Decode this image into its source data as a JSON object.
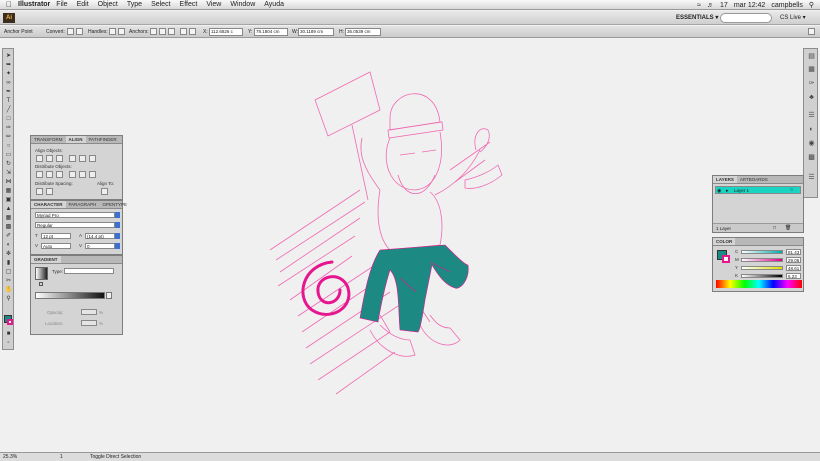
{
  "menubar": {
    "apple": "",
    "app_name": "Illustrator",
    "items": [
      "File",
      "Edit",
      "Object",
      "Type",
      "Select",
      "Effect",
      "View",
      "Window",
      "Ayuda"
    ],
    "status": {
      "battery": "17",
      "clock": "mar 12:42",
      "user": "campbells"
    }
  },
  "appbar": {
    "logo": "Ai",
    "workspace": "ESSENTIALS ▾",
    "cslive": "CS Live ▾"
  },
  "control": {
    "mode": "Anchor Point",
    "convert_label": "Convert:",
    "handles_label": "Handles:",
    "anchors_label": "Anchors:",
    "x_label": "X:",
    "x_value": "112.6826 c",
    "y_label": "Y:",
    "y_value": "78.1804 cm",
    "w_label": "W:",
    "w_value": "30.1189 cm",
    "h_label": "H:",
    "h_value": "36.0539 cm"
  },
  "align_panel": {
    "tabs": [
      "TRANSFORM",
      "ALIGN",
      "PATHFINDER"
    ],
    "align_objects": "Align Objects:",
    "distribute_objects": "Distribute Objects:",
    "distribute_spacing": "Distribute Spacing:",
    "align_to": "Align To:"
  },
  "character_panel": {
    "tabs": [
      "CHARACTER",
      "PARAGRAPH",
      "OPENTYPE"
    ],
    "font": "Myriad Pro",
    "style": "Regular",
    "size": "12 pt",
    "leading": "(14.4 pt)",
    "kerning": "Auto",
    "tracking": "0"
  },
  "gradient_panel": {
    "tab": "GRADIENT",
    "type_label": "Type:",
    "opacity_label": "Opacity:",
    "location_label": "Location:",
    "pct": "%"
  },
  "layers_panel": {
    "tabs": [
      "LAYERS",
      "ARTBOARDS"
    ],
    "layer_name": "Layer 1",
    "footer": "1 Layer",
    "layer_color": "#19d4c2"
  },
  "color_panel": {
    "tab": "COLOR",
    "channels": [
      {
        "label": "C",
        "value": "81.43"
      },
      {
        "label": "M",
        "value": "29.06"
      },
      {
        "label": "Y",
        "value": "48.61"
      },
      {
        "label": "K",
        "value": "6.23"
      }
    ],
    "fill_color": "#1a8a84"
  },
  "status": {
    "zoom": "25.3%",
    "page": "1",
    "message": "Toggle Direct Selection"
  },
  "colors": {
    "magenta": "#e6168f",
    "teal": "#1c8a82",
    "pink_line": "#f06ab2"
  }
}
